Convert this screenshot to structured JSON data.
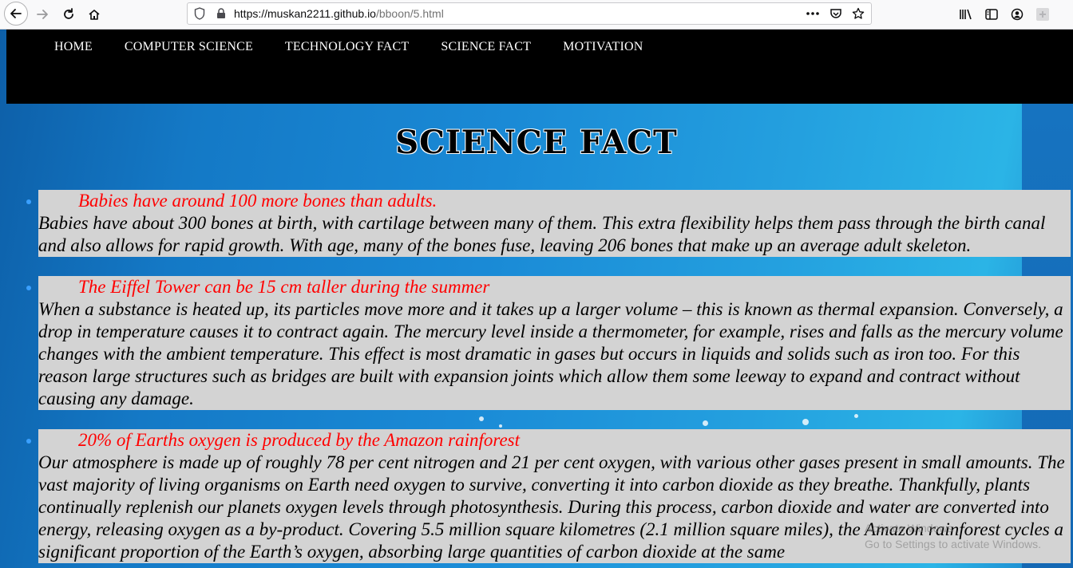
{
  "browser": {
    "url_host": "https://muskan2211.github.io",
    "url_path": "/bboon/5.html",
    "icons": [
      "back-icon",
      "forward-icon",
      "reload-icon",
      "home-icon",
      "shield-icon",
      "lock-icon",
      "more-icon",
      "pocket-icon",
      "bookmark-star-icon",
      "library-icon",
      "sidebar-icon",
      "account-icon",
      "extension-icon"
    ]
  },
  "nav": {
    "items": [
      {
        "label": "HOME"
      },
      {
        "label": "COMPUTER SCIENCE"
      },
      {
        "label": "TECHNOLOGY FACT"
      },
      {
        "label": "SCIENCE FACT"
      },
      {
        "label": "MOTIVATION"
      }
    ]
  },
  "page": {
    "title": "SCIENCE FACT"
  },
  "facts": [
    {
      "heading": "Babies have around 100 more bones than adults.",
      "body": "Babies have about 300 bones at birth, with cartilage between many of them. This extra flexibility helps them pass through the birth canal and also allows for rapid growth. With age, many of the bones fuse, leaving 206 bones that make up an average adult skeleton."
    },
    {
      "heading": "The Eiffel Tower can be 15 cm taller during the summer",
      "body": "When a substance is heated up, its particles move more and it takes up a larger volume – this is known as thermal expansion. Conversely, a drop in temperature causes it to contract again. The mercury level inside a thermometer, for example, rises and falls as the mercury volume changes with the ambient temperature. This effect is most dramatic in gases but occurs in liquids and solids such as iron too. For this reason large structures such as bridges are built with expansion joints which allow them some leeway to expand and contract without causing any damage."
    },
    {
      "heading": "20% of Earths oxygen is produced by the Amazon rainforest",
      "body": "Our atmosphere is made up of roughly 78 per cent nitrogen and 21 per cent oxygen, with various other gases present in small amounts. The vast majority of living organisms on Earth need oxygen to survive, converting it into carbon dioxide as they breathe. Thankfully, plants continually replenish our planets oxygen levels through photosynthesis. During this process, carbon dioxide and water are converted into energy, releasing oxygen as a by-product. Covering 5.5 million square kilometres (2.1 million square miles), the Amazon rainforest cycles a significant proportion of the Earth’s oxygen, absorbing large quantities of carbon dioxide at the same"
    }
  ],
  "watermark": {
    "line1": "Activate Windows",
    "line2": "Go to Settings to activate Windows."
  }
}
